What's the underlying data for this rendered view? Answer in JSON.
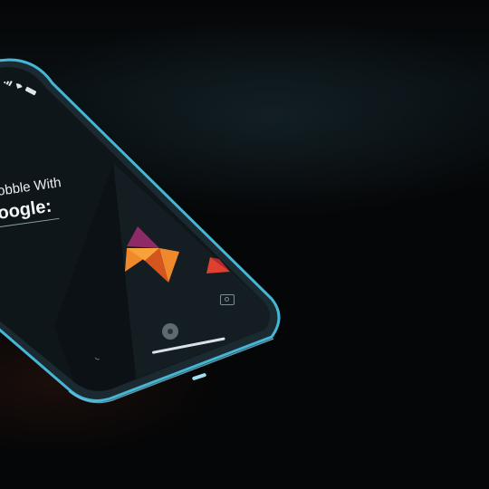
{
  "screen": {
    "headline_line1": "obble With",
    "headline_line2": "oogle:"
  },
  "icons": {
    "app_logo": "orange-triangle-logo-icon",
    "secondary_logo": "red-triangle-logo-icon",
    "camera": "camera-icon",
    "home": "home-dot-icon",
    "phone": "phone-icon",
    "signal": "signal-icon",
    "wifi": "wifi-icon",
    "battery": "battery-icon"
  },
  "colors": {
    "background": "#050607",
    "phone_frame": "#46b6d6",
    "screen": "#0f161a",
    "logo_orange": "#f0892c",
    "logo_red": "#e0402f",
    "logo_magenta": "#8e2a66"
  }
}
